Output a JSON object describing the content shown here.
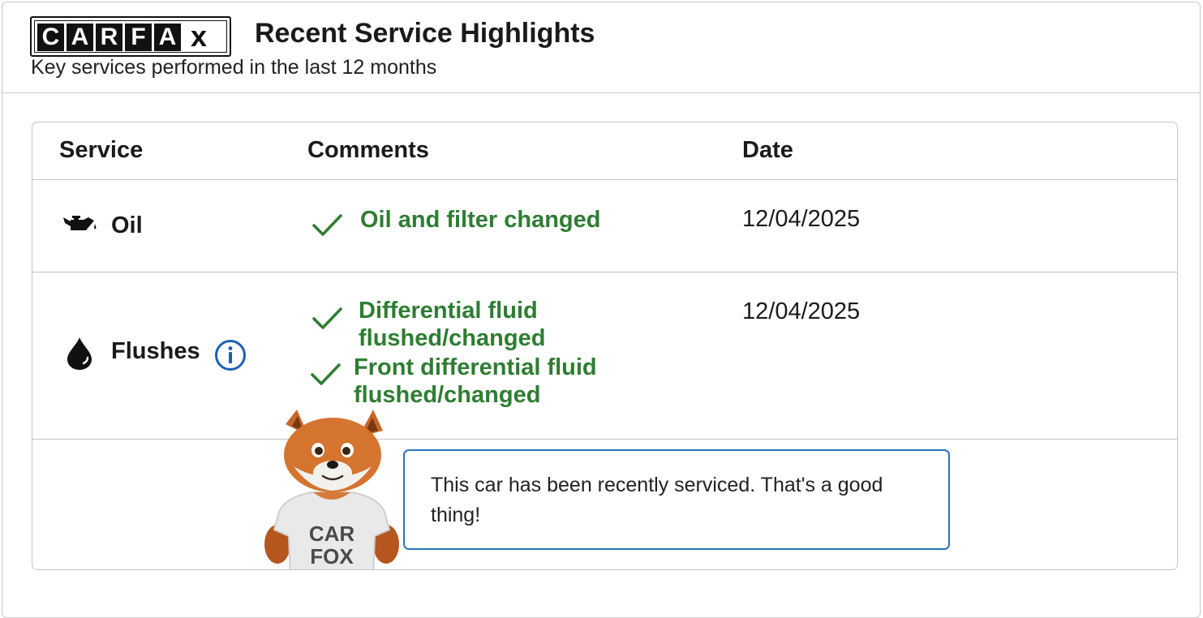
{
  "logo": {
    "letters": [
      "C",
      "A",
      "R",
      "F",
      "A"
    ],
    "x": "x"
  },
  "header": {
    "title": "Recent Service Highlights",
    "subtitle": "Key services performed in the last 12 months"
  },
  "table": {
    "columns": [
      "Service",
      "Comments",
      "Date"
    ],
    "rows": [
      {
        "service": "Oil",
        "icon": "oil-can-icon",
        "comments": [
          "Oil and filter changed"
        ],
        "date": "12/04/2025"
      },
      {
        "service": "Flushes",
        "icon": "fluid-drop-icon",
        "has_info": true,
        "comments": [
          "Differential fluid flushed/changed",
          "Front differential fluid flushed/changed"
        ],
        "date": "12/04/2025"
      }
    ]
  },
  "callout": {
    "message": "This car has been recently serviced. That's a good thing!",
    "mascot_shirt": [
      "CAR",
      "FOX"
    ]
  },
  "colors": {
    "accent_green": "#2e7d32",
    "info_blue": "#1a5fb4",
    "bubble_border": "#2a74c0"
  }
}
